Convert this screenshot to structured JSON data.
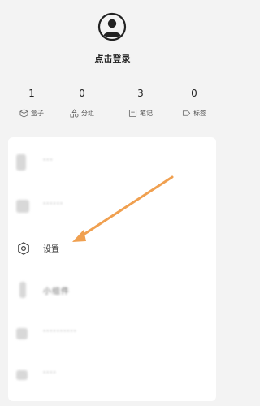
{
  "profile": {
    "login_label": "点击登录"
  },
  "stats": [
    {
      "count": "1",
      "label": "盒子",
      "icon": "box-icon"
    },
    {
      "count": "0",
      "label": "分组",
      "icon": "group-icon"
    },
    {
      "count": "3",
      "label": "笔记",
      "icon": "note-icon"
    },
    {
      "count": "0",
      "label": "标签",
      "icon": "tag-icon"
    }
  ],
  "menu": {
    "items": [
      {
        "label": "···",
        "icon": "blurred-icon"
      },
      {
        "label": "······",
        "icon": "blurred-icon"
      },
      {
        "label": "设置",
        "icon": "settings-icon"
      },
      {
        "label": "小组件",
        "icon": "blurred-icon"
      },
      {
        "label": "··········",
        "icon": "blurred-icon"
      },
      {
        "label": "····",
        "icon": "blurred-icon"
      }
    ]
  },
  "annotation": {
    "arrow_color": "#f0a050"
  }
}
